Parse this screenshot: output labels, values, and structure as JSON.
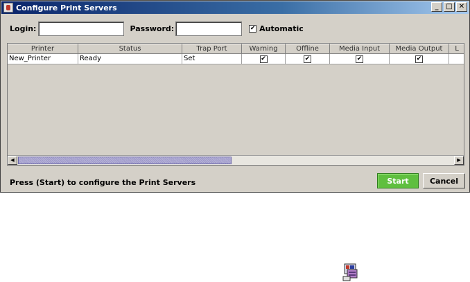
{
  "window": {
    "title": "Configure Print Servers",
    "controls": {
      "minimize": "_",
      "maximize": "□",
      "close": "✕"
    }
  },
  "form": {
    "login_label": "Login:",
    "login_value": "",
    "password_label": "Password:",
    "password_value": "",
    "automatic_label": "Automatic",
    "automatic_checked": true
  },
  "table": {
    "columns": [
      "Printer",
      "Status",
      "Trap Port",
      "Warning",
      "Offline",
      "Media Input",
      "Media Output",
      "L"
    ],
    "rows": [
      {
        "printer": "New_Printer",
        "status": "Ready",
        "trap_port": "Set",
        "warning": true,
        "offline": true,
        "media_input": true,
        "media_output": true
      }
    ],
    "check_mark": "✔"
  },
  "scrollbar": {
    "left_arrow": "◀",
    "right_arrow": "▶"
  },
  "footer": {
    "message": "Press (Start) to configure the Print Servers",
    "start_label": "Start",
    "cancel_label": "Cancel"
  },
  "colors": {
    "accent_start": "#5fbf3f",
    "titlebar": "#0a246a",
    "window_bg": "#d4d0c8"
  },
  "icons": {
    "title_icon": "java-app-icon",
    "desktop_icon": "print-server-icon"
  }
}
